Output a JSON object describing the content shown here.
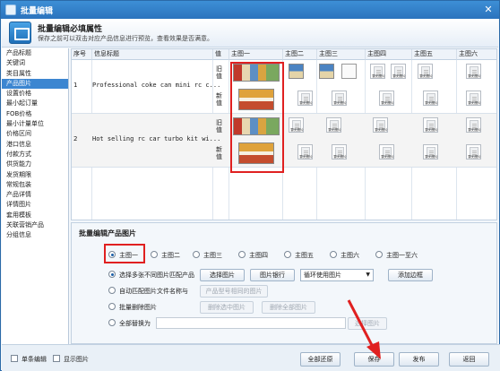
{
  "window": {
    "title": "批量编辑"
  },
  "header": {
    "title": "批量编辑必填属性",
    "description": "保存之前可以双击对应产品信息进行预览，查看效果是否满意。"
  },
  "sidebar": {
    "items": [
      {
        "label": "产品标题",
        "active": false
      },
      {
        "label": "关键词",
        "active": false
      },
      {
        "label": "类目属性",
        "active": false
      },
      {
        "label": "产品图片",
        "active": true
      },
      {
        "label": "设置价格",
        "active": false
      },
      {
        "label": "最小起订量",
        "active": false
      },
      {
        "label": "FOB价格",
        "active": false
      },
      {
        "label": "最小计量单位",
        "active": false
      },
      {
        "label": "价格区间",
        "active": false
      },
      {
        "label": "港口信息",
        "active": false
      },
      {
        "label": "付款方式",
        "active": false
      },
      {
        "label": "供货能力",
        "active": false
      },
      {
        "label": "发货期限",
        "active": false
      },
      {
        "label": "常规包装",
        "active": false
      },
      {
        "label": "产品详情",
        "active": false
      },
      {
        "label": "详情图片",
        "active": false
      },
      {
        "label": "套用模板",
        "active": false
      },
      {
        "label": "关联营销产品",
        "active": false
      },
      {
        "label": "分组信息",
        "active": false
      }
    ]
  },
  "grid": {
    "columns": [
      "序号",
      "信息标题",
      "值",
      "主图一",
      "主图二",
      "主图三",
      "主图四",
      "主图五",
      "主图六"
    ],
    "rows": [
      {
        "no": "1",
        "title": "Professional coke can mini rc c...",
        "old_label": "旧值",
        "new_label": "新值"
      },
      {
        "no": "2",
        "title": "Hot selling rc car turbo kit wi...",
        "old_label": "旧值",
        "new_label": "新值"
      }
    ],
    "placeholder_text": "暂无图片"
  },
  "batch": {
    "title": "批量编辑产品图片",
    "targets": [
      {
        "label": "主图一",
        "selected": true
      },
      {
        "label": "主图二",
        "selected": false
      },
      {
        "label": "主图三",
        "selected": false
      },
      {
        "label": "主图四",
        "selected": false
      },
      {
        "label": "主图五",
        "selected": false
      },
      {
        "label": "主图六",
        "selected": false
      },
      {
        "label": "主图一至六",
        "selected": false
      }
    ],
    "option1": {
      "label": "选择多张不同图片匹配产品",
      "selected": true,
      "choose_btn": "选择图片",
      "bank_btn": "图片银行",
      "mode_value": "循环使用图片",
      "border_btn": "添加边框"
    },
    "option2": {
      "label": "自动匹配图片文件名称与",
      "match_btn": "产品型号相同的图片"
    },
    "option3": {
      "label": "批量删除图片",
      "delete_selected_btn": "删除选中图片",
      "delete_all_btn": "删除全部图片"
    },
    "option4": {
      "label": "全部替换为",
      "choose_btn": "选择图片"
    }
  },
  "footer": {
    "single_edit_label": "单条编辑",
    "show_images_label": "显示图片",
    "restore_btn": "全部还原",
    "save_btn": "保存",
    "publish_btn": "发布",
    "back_btn": "返回"
  },
  "colors": {
    "accent": "#3c86d1",
    "highlight": "#e02020",
    "title_bar": "#2b73bd"
  }
}
